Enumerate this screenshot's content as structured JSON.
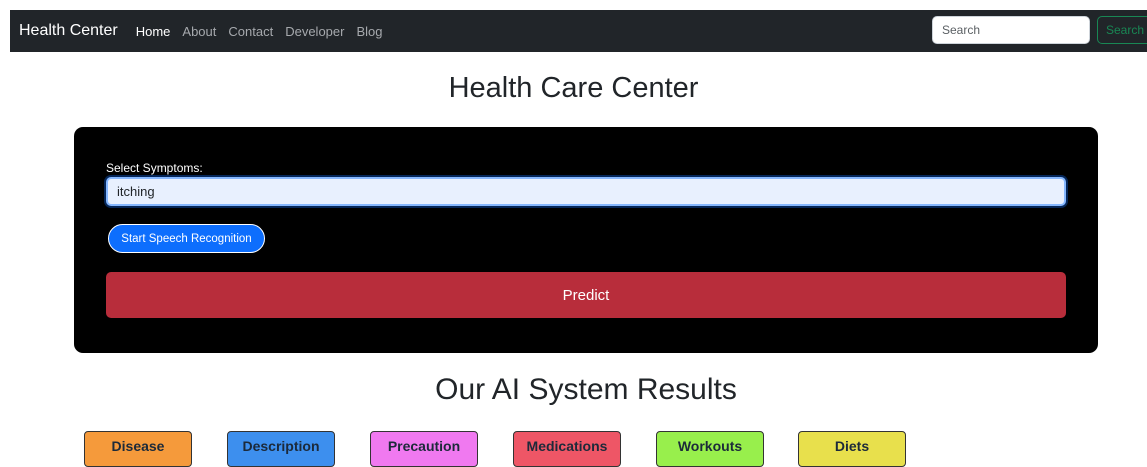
{
  "navbar": {
    "brand": "Health Center",
    "links": [
      "Home",
      "About",
      "Contact",
      "Developer",
      "Blog"
    ],
    "search_placeholder": "Search",
    "search_button": "Search"
  },
  "main": {
    "title": "Health Care Center",
    "form": {
      "symptoms_label": "Select Symptoms:",
      "symptoms_value": "itching",
      "speech_button": "Start Speech Recognition",
      "predict_button": "Predict"
    },
    "results_title": "Our AI System Results",
    "result_buttons": [
      {
        "label": "Disease",
        "color": "#f59a3b"
      },
      {
        "label": "Description",
        "color": "#3d8fee"
      },
      {
        "label": "Precaution",
        "color": "#f079f0"
      },
      {
        "label": "Medications",
        "color": "#ee5666"
      },
      {
        "label": "Workouts",
        "color": "#98ef4c"
      },
      {
        "label": "Diets",
        "color": "#e8e04c"
      }
    ]
  },
  "colors": {
    "navbar_bg": "#212529",
    "panel_bg": "#000000",
    "predict_bg": "#b82d3b",
    "speech_bg": "#0d6efd",
    "search_accent": "#198754"
  }
}
